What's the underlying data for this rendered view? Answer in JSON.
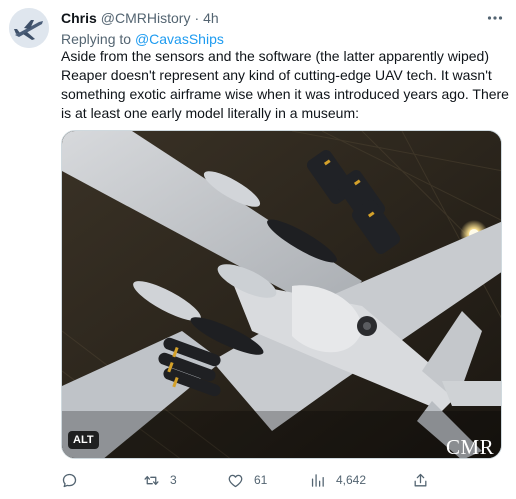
{
  "tweet": {
    "author_name": "Chris",
    "author_handle": "@CMRHistory",
    "separator": "·",
    "time": "4h",
    "replying_prefix": "Replying to",
    "replying_to": "@CavasShips",
    "body_lines": [
      "Aside from the sensors and the software (the latter apparently wiped)",
      "Reaper doesn't represent any kind of cutting-edge UAV tech. It wasn't",
      "something exotic airframe wise when it was introduced years ago. There",
      "is at least one early model literally in a museum:"
    ],
    "media": {
      "alt_badge": "ALT",
      "watermark": "CMR"
    },
    "actions": {
      "reply_count": "",
      "retweet_count": "3",
      "like_count": "61",
      "views_count": "4,642"
    }
  },
  "icons": {
    "more": "more-horizontal-icon",
    "reply": "reply-icon",
    "retweet": "retweet-icon",
    "like": "heart-icon",
    "views": "views-icon",
    "share": "share-icon"
  },
  "colors": {
    "text": "#0f1419",
    "secondary": "#536471",
    "link": "#1d9bf0",
    "border": "#cfd9de"
  }
}
